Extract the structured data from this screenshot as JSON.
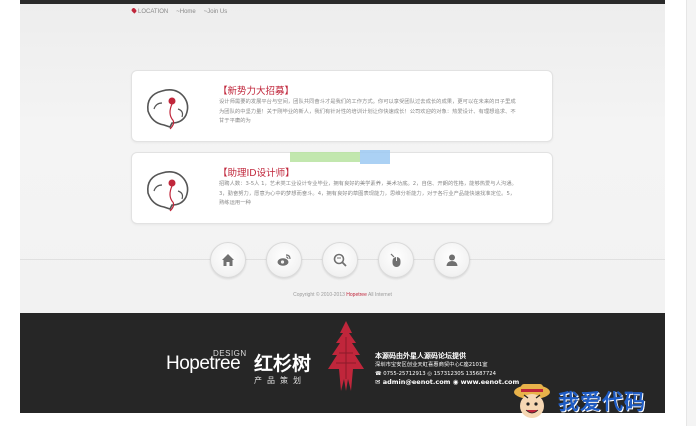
{
  "breadcrumb": {
    "location": "LOCATION",
    "home": "~Home",
    "current": "~Join Us"
  },
  "jobs": [
    {
      "title": "【新势力大招募】",
      "body": "设计师需要的发展平台与空间，团队共同奋斗才是我们的工作方式。你可以享受团队过去成长的成果，更可以在未来的日子里成为团队的中坚力量！关于刚毕业的新人，我们有针对性的培训计划让你快速成长！公司欢迎的对象：热爱设计、有理想追求、不甘于平庸的为"
    },
    {
      "title": "【助理ID设计师】",
      "body": "招聘人数：3-5人 1，艺术类工业设计专业毕业，拥有良好的美学素养，美术功底。2，自信、开朗的性格，能够热爱与人沟通。3，勤奋努力，愿意为心中的梦想而奋斗。4，拥有良好的草图表现能力，思维分析能力，对于各行业产品能快速找准定位。5，熟练运用一种"
    }
  ],
  "nav_icons": [
    "home-icon",
    "weibo-icon",
    "search-icon",
    "mouse-icon",
    "user-icon"
  ],
  "copyright": {
    "prefix": "Copyright © 2010-2013",
    "brand": "Hopetree",
    "suffix": "All Internet"
  },
  "footer": {
    "design": "DESIGN",
    "brand_en": "Hopetree",
    "brand_cn": "红杉树",
    "subtitle": "产品策划",
    "contact_line1": "本源码由外星人源码论坛提供",
    "contact_line2": "深圳市宝安区创业天虹喜惠商贸中心C座2101室",
    "contact_line3": "☎ 0755-25712913  ◎ 15731230S  135687724",
    "contact_line4": "✉ admin@eenot.com  ◉ www.eenot.com"
  },
  "watermark": {
    "text": "我爱代码"
  },
  "colors": {
    "accent": "#c0263b",
    "footer_bg": "#262626",
    "watermark": "#1f5cc4"
  }
}
